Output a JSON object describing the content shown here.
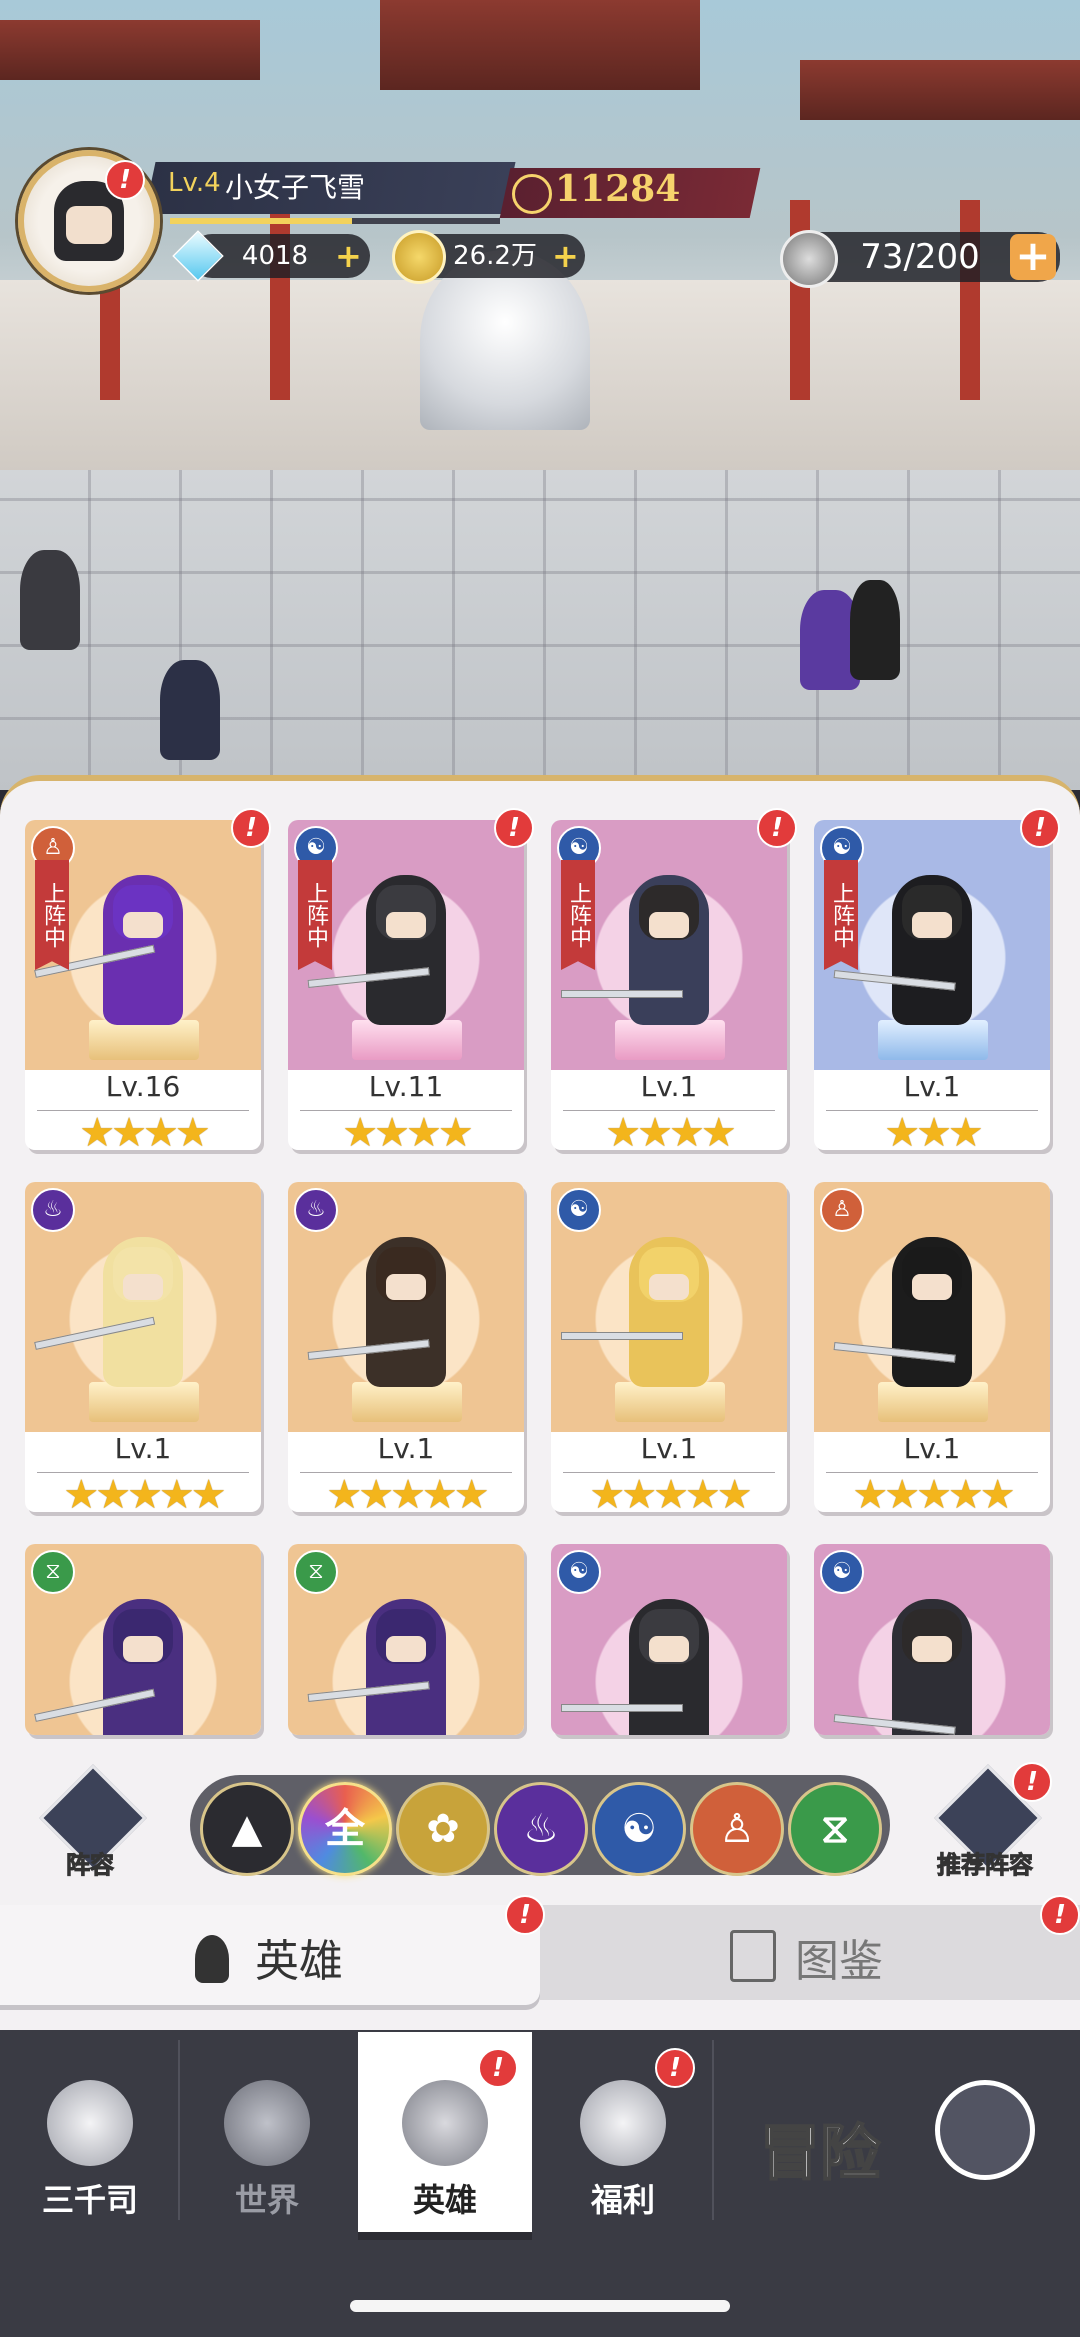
{
  "player": {
    "level": "Lv.4",
    "name": "小女子飞雪",
    "power": "11284"
  },
  "resources": {
    "gems": "4018",
    "gold": "26.2万",
    "stamina": "73/200",
    "plus": "+"
  },
  "alert_mark": "!",
  "heroes": [
    {
      "level": "Lv.16",
      "stars": "★★★★",
      "element": "body",
      "banner": "上阵中",
      "bg": "orange"
    },
    {
      "level": "Lv.11",
      "stars": "★★★★",
      "element": "yin-yang",
      "banner": "上阵中",
      "bg": "pink"
    },
    {
      "level": "Lv.1",
      "stars": "★★★★",
      "element": "yin-yang",
      "banner": "上阵中",
      "bg": "pink"
    },
    {
      "level": "Lv.1",
      "stars": "★★★",
      "element": "yin-yang",
      "banner": "上阵中",
      "bg": "blue"
    },
    {
      "level": "Lv.1",
      "stars": "★★★★★",
      "element": "flame",
      "bg": "orange"
    },
    {
      "level": "Lv.1",
      "stars": "★★★★★",
      "element": "flame",
      "bg": "orange"
    },
    {
      "level": "Lv.1",
      "stars": "★★★★★",
      "element": "yin-yang",
      "bg": "orange"
    },
    {
      "level": "Lv.1",
      "stars": "★★★★★",
      "element": "body",
      "bg": "orange"
    },
    {
      "element": "dna",
      "bg": "orange"
    },
    {
      "element": "dna",
      "bg": "orange"
    },
    {
      "element": "yin-yang",
      "bg": "pink"
    },
    {
      "element": "yin-yang",
      "bg": "pink"
    }
  ],
  "filters": {
    "lineup": "阵容",
    "all": "全",
    "recommend": "推荐阵容"
  },
  "tabs": {
    "heroes": "英雄",
    "codex": "图鉴"
  },
  "nav": {
    "sanqiansi": "三千司",
    "world": "世界",
    "heroes": "英雄",
    "welfare": "福利",
    "adventure": "冒险"
  },
  "colors": {
    "accent_gold": "#d7b46c",
    "alert_red": "#e23b3b",
    "star": "#f3b51c"
  }
}
